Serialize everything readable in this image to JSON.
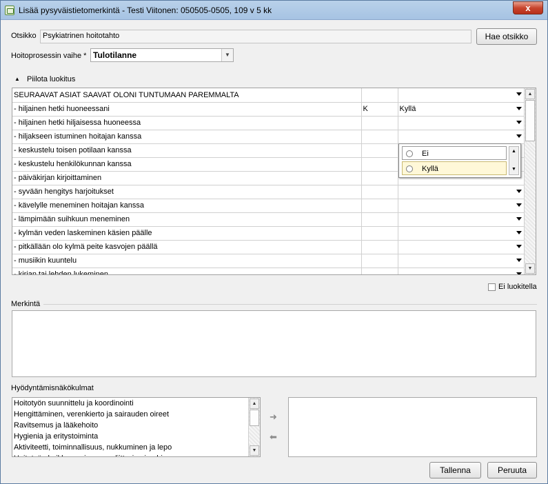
{
  "window": {
    "title": "Lisää pysyväistietomerkintä - Testi Viitonen: 050505-0505, 109 v 5 kk",
    "close_label": "x"
  },
  "otsikko": {
    "label": "Otsikko",
    "value": "Psykiatrinen hoitotahto",
    "fetch_button": "Hae otsikko"
  },
  "phase": {
    "label": "Hoitoprosessin vaihe *",
    "value": "Tulotilanne"
  },
  "classification": {
    "toggle_icon": "▲",
    "toggle_label": "Piilota luokitus",
    "rows": [
      {
        "text": "SEURAAVAT ASIAT SAAVAT OLONI TUNTUMAAN PAREMMALTA",
        "code": "",
        "value": ""
      },
      {
        "text": "- hiljainen hetki huoneessani",
        "code": "K",
        "value": "Kyllä"
      },
      {
        "text": "- hiljainen hetki hiljaisessa huoneessa",
        "code": "",
        "value": ""
      },
      {
        "text": "- hiljakseen istuminen hoitajan kanssa",
        "code": "",
        "value": ""
      },
      {
        "text": "- keskustelu toisen potilaan kanssa",
        "code": "",
        "value": ""
      },
      {
        "text": "- keskustelu henkilökunnan kanssa",
        "code": "",
        "value": ""
      },
      {
        "text": "- päiväkirjan kirjoittaminen",
        "code": "",
        "value": ""
      },
      {
        "text": "- syvään hengitys harjoitukset",
        "code": "",
        "value": ""
      },
      {
        "text": "- kävelylle meneminen hoitajan kanssa",
        "code": "",
        "value": ""
      },
      {
        "text": "- lämpimään suihkuun meneminen",
        "code": "",
        "value": ""
      },
      {
        "text": "- kylmän veden laskeminen käsien päälle",
        "code": "",
        "value": ""
      },
      {
        "text": "- pitkällään olo kylmä peite kasvojen päällä",
        "code": "",
        "value": ""
      },
      {
        "text": "- musiikin kuuntelu",
        "code": "",
        "value": ""
      },
      {
        "text": "- kirjan tai lehden lukeminen",
        "code": "",
        "value": ""
      }
    ],
    "popup_options": [
      "Ei",
      "Kyllä"
    ]
  },
  "no_classification": {
    "label": "Ei luokitella"
  },
  "merkinta": {
    "label": "Merkintä"
  },
  "perspectives": {
    "label": "Hyödyntämisnäkökulmat",
    "items": [
      "Hoitotyön suunnittelu ja koordinointi",
      "Hengittäminen, verenkierto ja sairauden oireet",
      "Ravitsemus ja lääkehoito",
      "Hygienia ja eritystoiminta",
      "Aktiviteetti, toiminnallisuus, nukkuminen ja lepo",
      "Hoitotyön kaikkeen oireeseen liittyvien ja ohjaus"
    ],
    "add_arrow": "➜",
    "remove_arrow": "⬅"
  },
  "buttons": {
    "save": "Tallenna",
    "cancel": "Peruuta"
  }
}
